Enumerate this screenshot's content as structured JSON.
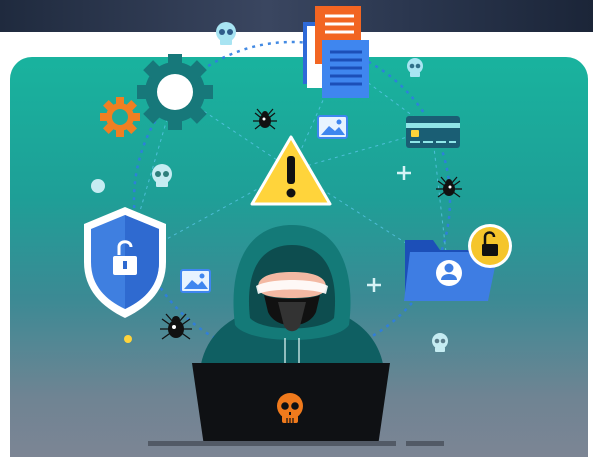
{
  "illustration": {
    "alt": "",
    "palette": {
      "panel_top": "#19b39e",
      "panel_bottom": "#7c8594",
      "hood": "#147a78",
      "laptop": "#0f1114",
      "skull": "#f07a1c",
      "warning": "#ffd43b",
      "shield": "#3f7fe0",
      "folder": "#3e7de3",
      "lock_badge": "#f5c52b",
      "gear_dark": "#17787a",
      "gear_orange": "#f07f22"
    },
    "icons": [
      "warning-icon",
      "shield-lock-icon",
      "gear-icon",
      "document-icon",
      "credit-card-icon",
      "folder-user-icon",
      "unlock-icon",
      "bug-icon",
      "skull-icon",
      "image-icon",
      "plus-icon"
    ]
  }
}
